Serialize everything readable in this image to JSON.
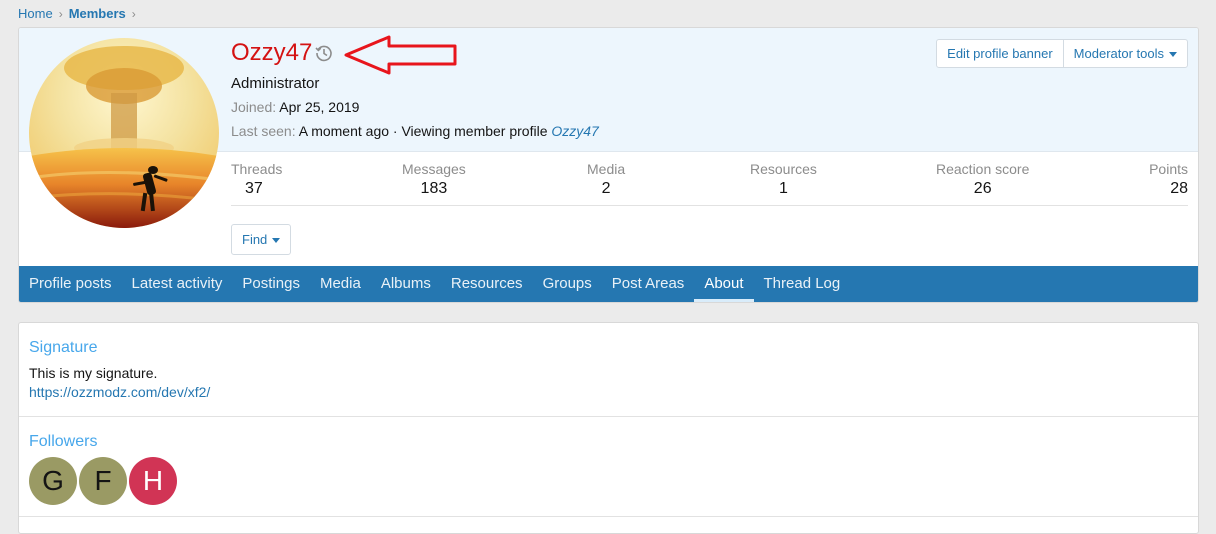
{
  "breadcrumb": {
    "home": "Home",
    "members": "Members",
    "sep": "›"
  },
  "profile": {
    "username": "Ozzy47",
    "title": "Administrator",
    "joined_label": "Joined:",
    "joined_value": "Apr 25, 2019",
    "lastseen_label": "Last seen:",
    "lastseen_value": "A moment ago · Viewing member profile",
    "lastseen_user": "Ozzy47",
    "username_color": "#d41212",
    "icons": [
      "history-icon",
      "red-arrow-annotation"
    ]
  },
  "buttons": {
    "edit_banner": "Edit profile banner",
    "moderator_tools": "Moderator tools",
    "find": "Find"
  },
  "stats": [
    {
      "label": "Threads",
      "value": "37"
    },
    {
      "label": "Messages",
      "value": "183"
    },
    {
      "label": "Media",
      "value": "2"
    },
    {
      "label": "Resources",
      "value": "1"
    },
    {
      "label": "Reaction score",
      "value": "26"
    },
    {
      "label": "Points",
      "value": "28"
    }
  ],
  "tabs": [
    {
      "label": "Profile posts"
    },
    {
      "label": "Latest activity"
    },
    {
      "label": "Postings"
    },
    {
      "label": "Media"
    },
    {
      "label": "Albums"
    },
    {
      "label": "Resources"
    },
    {
      "label": "Groups"
    },
    {
      "label": "Post Areas"
    },
    {
      "label": "About",
      "active": true
    },
    {
      "label": "Thread Log"
    }
  ],
  "about": {
    "signature_title": "Signature",
    "signature_text": "This is my signature.",
    "signature_link": "https://ozzmodz.com/dev/xf2/",
    "followers_title": "Followers",
    "followers": [
      {
        "letter": "G",
        "color": "#9a9a64"
      },
      {
        "letter": "F",
        "color": "#9a9a64"
      },
      {
        "letter": "H",
        "color": "#d13455"
      }
    ]
  },
  "colors": {
    "accent": "#2577b1",
    "section_title": "#47a7eb",
    "banner_bg": "#edf6fd",
    "tab_bar": "#2577b1"
  }
}
